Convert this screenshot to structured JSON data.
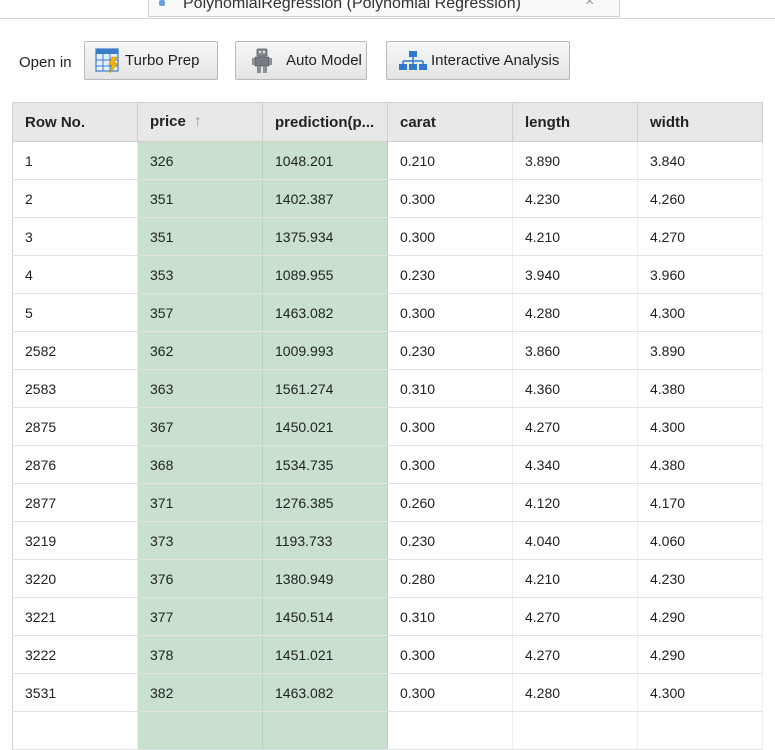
{
  "tab": {
    "title": "PolynomialRegression (Polynomial Regression)",
    "close_glyph": "×"
  },
  "toolbar": {
    "open_in_label": "Open in",
    "turbo_prep_label": "Turbo Prep",
    "auto_model_label": "Auto Model",
    "interactive_analysis_label": "Interactive Analysis"
  },
  "table": {
    "columns": [
      "Row No.",
      "price",
      "prediction(p...",
      "carat",
      "length",
      "width"
    ],
    "sort_indicator": "↑",
    "highlight_colors": {
      "header": "#e8e8e8",
      "selected_column": "#c8e0cd"
    },
    "rows": [
      [
        "1",
        "326",
        "1048.201",
        "0.210",
        "3.890",
        "3.840"
      ],
      [
        "2",
        "351",
        "1402.387",
        "0.300",
        "4.230",
        "4.260"
      ],
      [
        "3",
        "351",
        "1375.934",
        "0.300",
        "4.210",
        "4.270"
      ],
      [
        "4",
        "353",
        "1089.955",
        "0.230",
        "3.940",
        "3.960"
      ],
      [
        "5",
        "357",
        "1463.082",
        "0.300",
        "4.280",
        "4.300"
      ],
      [
        "2582",
        "362",
        "1009.993",
        "0.230",
        "3.860",
        "3.890"
      ],
      [
        "2583",
        "363",
        "1561.274",
        "0.310",
        "4.360",
        "4.380"
      ],
      [
        "2875",
        "367",
        "1450.021",
        "0.300",
        "4.270",
        "4.300"
      ],
      [
        "2876",
        "368",
        "1534.735",
        "0.300",
        "4.340",
        "4.380"
      ],
      [
        "2877",
        "371",
        "1276.385",
        "0.260",
        "4.120",
        "4.170"
      ],
      [
        "3219",
        "373",
        "1193.733",
        "0.230",
        "4.040",
        "4.060"
      ],
      [
        "3220",
        "376",
        "1380.949",
        "0.280",
        "4.210",
        "4.230"
      ],
      [
        "3221",
        "377",
        "1450.514",
        "0.310",
        "4.270",
        "4.290"
      ],
      [
        "3222",
        "378",
        "1451.021",
        "0.300",
        "4.270",
        "4.290"
      ],
      [
        "3531",
        "382",
        "1463.082",
        "0.300",
        "4.280",
        "4.300"
      ],
      [
        "",
        "",
        "",
        "",
        "",
        ""
      ]
    ]
  },
  "icons": {
    "turbo_prep": "grid-lightning-icon",
    "auto_model": "robot-icon",
    "interactive_analysis": "hierarchy-icon"
  }
}
